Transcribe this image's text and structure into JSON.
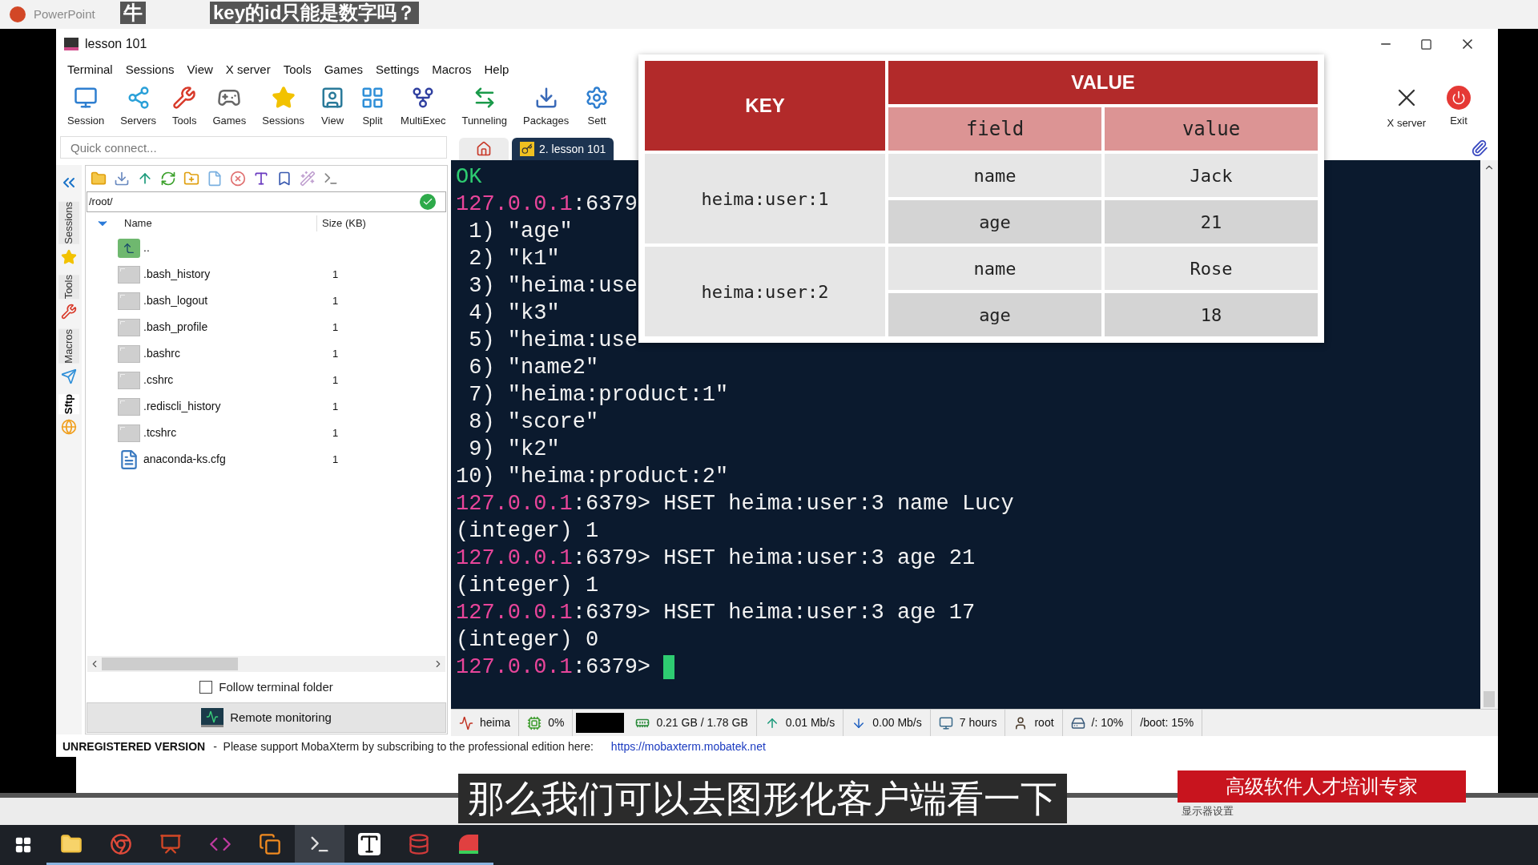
{
  "presentation": {
    "title": "PowerPoint",
    "captions": [
      {
        "text": "牛"
      },
      {
        "text": "key的id只能是数字吗？"
      }
    ]
  },
  "window": {
    "title": "lesson 101"
  },
  "menu": [
    "Terminal",
    "Sessions",
    "View",
    "X server",
    "Tools",
    "Games",
    "Settings",
    "Macros",
    "Help"
  ],
  "toolbar": [
    {
      "kind": "session",
      "label": "Session"
    },
    {
      "kind": "servers",
      "label": "Servers"
    },
    {
      "kind": "tools",
      "label": "Tools"
    },
    {
      "kind": "games",
      "label": "Games"
    },
    {
      "kind": "sessions",
      "label": "Sessions"
    },
    {
      "kind": "view",
      "label": "View"
    },
    {
      "kind": "split",
      "label": "Split"
    },
    {
      "kind": "multiexec",
      "label": "MultiExec"
    },
    {
      "kind": "tunneling",
      "label": "Tunneling"
    },
    {
      "kind": "packages",
      "label": "Packages"
    },
    {
      "kind": "settings",
      "label": "Sett"
    }
  ],
  "toolbar_right": [
    {
      "kind": "xserver",
      "label": "X server"
    },
    {
      "kind": "exit",
      "label": "Exit"
    }
  ],
  "quick_connect": {
    "placeholder": "Quick connect..."
  },
  "side_tabs": [
    {
      "label": "Sessions",
      "selected": false
    },
    {
      "label": "Tools",
      "selected": false
    },
    {
      "label": "Macros",
      "selected": false
    },
    {
      "label": "Sftp",
      "selected": true
    }
  ],
  "sftp": {
    "path": "/root/",
    "columns": [
      "Name",
      "Size (KB)"
    ],
    "files": [
      {
        "kind": "up",
        "name": ".."
      },
      {
        "kind": "script",
        "name": ".bash_history",
        "size": "1"
      },
      {
        "kind": "script",
        "name": ".bash_logout",
        "size": "1"
      },
      {
        "kind": "script",
        "name": ".bash_profile",
        "size": "1"
      },
      {
        "kind": "script",
        "name": ".bashrc",
        "size": "1"
      },
      {
        "kind": "script",
        "name": ".cshrc",
        "size": "1"
      },
      {
        "kind": "script",
        "name": ".rediscli_history",
        "size": "1"
      },
      {
        "kind": "script",
        "name": ".tcshrc",
        "size": "1"
      },
      {
        "kind": "config",
        "name": "anaconda-ks.cfg",
        "size": "1"
      }
    ],
    "follow_terminal_folder": {
      "label": "Follow terminal folder",
      "checked": false
    },
    "remote_monitoring": "Remote monitoring"
  },
  "tabs": [
    {
      "kind": "home",
      "selected": false
    },
    {
      "kind": "session",
      "label": "2. lesson 101",
      "selected": true
    }
  ],
  "terminal": {
    "lines": [
      {
        "kind": "ok",
        "text": "OK"
      },
      {
        "kind": "prompt",
        "host": "127.0.0.1",
        "port": ":6379"
      },
      {
        "kind": "output",
        "text": " 1) \"age\""
      },
      {
        "kind": "output",
        "text": " 2) \"k1\""
      },
      {
        "kind": "output",
        "text": " 3) \"heima:use"
      },
      {
        "kind": "output",
        "text": " 4) \"k3\""
      },
      {
        "kind": "output",
        "text": " 5) \"heima:use"
      },
      {
        "kind": "output",
        "text": " 6) \"name2\""
      },
      {
        "kind": "output",
        "text": " 7) \"heima:product:1\""
      },
      {
        "kind": "output",
        "text": " 8) \"score\""
      },
      {
        "kind": "output",
        "text": " 9) \"k2\""
      },
      {
        "kind": "output",
        "text": "10) \"heima:product:2\""
      },
      {
        "kind": "prompt",
        "host": "127.0.0.1",
        "port": ":6379>",
        "command": "HSET heima:user:3 name Lucy"
      },
      {
        "kind": "output",
        "text": "(integer) 1"
      },
      {
        "kind": "prompt",
        "host": "127.0.0.1",
        "port": ":6379>",
        "command": "HSET heima:user:3 age 21"
      },
      {
        "kind": "output",
        "text": "(integer) 1"
      },
      {
        "kind": "prompt",
        "host": "127.0.0.1",
        "port": ":6379>",
        "command": "HSET heima:user:3 age 17"
      },
      {
        "kind": "output",
        "text": "(integer) 0"
      },
      {
        "kind": "prompt",
        "host": "127.0.0.1",
        "port": ":6379>",
        "cursor": true
      }
    ]
  },
  "status_bar": [
    {
      "kind": "host",
      "text": "heima"
    },
    {
      "kind": "cpu",
      "text": "0%"
    },
    {
      "kind": "graph"
    },
    {
      "kind": "ram",
      "text": "0.21 GB / 1.78 GB"
    },
    {
      "kind": "upload",
      "text": "0.01 Mb/s"
    },
    {
      "kind": "download",
      "text": "0.00 Mb/s"
    },
    {
      "kind": "uptime",
      "text": "7 hours"
    },
    {
      "kind": "user",
      "text": "root"
    },
    {
      "kind": "disk",
      "text": "/: 10%"
    },
    {
      "kind": "plain",
      "text": "/boot: 15%"
    }
  ],
  "footer": {
    "version": "UNREGISTERED VERSION",
    "message": "-  Please support MobaXterm by subscribing to the professional edition here:",
    "link": "https://mobaxterm.mobatek.net"
  },
  "hash_table": {
    "key_header": "KEY",
    "value_header": "VALUE",
    "sub_headers": [
      "field",
      "value"
    ],
    "rows": [
      {
        "key": "heima:user:1",
        "entries": [
          {
            "field": "name",
            "value": "Jack"
          },
          {
            "field": "age",
            "value": "21"
          }
        ]
      },
      {
        "key": "heima:user:2",
        "entries": [
          {
            "field": "name",
            "value": "Rose"
          },
          {
            "field": "age",
            "value": "18"
          }
        ]
      }
    ]
  },
  "slide": {
    "banner": "高级软件人才培训专家",
    "tray_text": "显示器设置"
  },
  "subtitle": "那么我们可以去图形化客户端看一下",
  "taskbar": [
    {
      "kind": "explorer",
      "selected": false
    },
    {
      "kind": "chrome",
      "selected": false
    },
    {
      "kind": "powerpoint",
      "selected": false
    },
    {
      "kind": "ide",
      "selected": false
    },
    {
      "kind": "vm",
      "selected": false
    },
    {
      "kind": "terminal",
      "selected": true
    },
    {
      "kind": "typora",
      "selected": false
    },
    {
      "kind": "redis",
      "selected": false
    },
    {
      "kind": "tool",
      "selected": false
    }
  ]
}
